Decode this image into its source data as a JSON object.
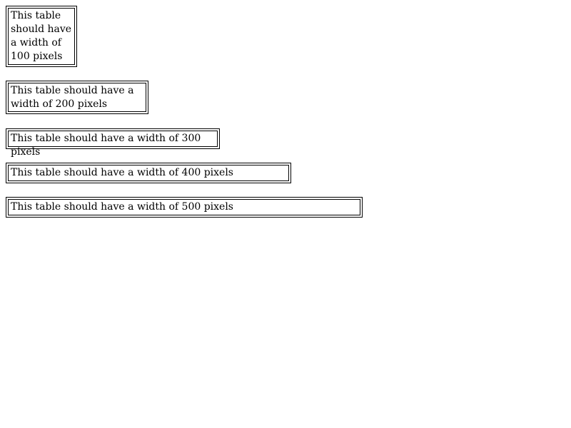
{
  "tables": [
    {
      "text": "This table should have a width of 100 pixels"
    },
    {
      "text": "This table should have a width of 200 pixels"
    },
    {
      "text": "This table should have a width of 300 pixels"
    },
    {
      "text": "This table should have a width of 400 pixels"
    },
    {
      "text": "This table should have a width of 500 pixels"
    }
  ]
}
